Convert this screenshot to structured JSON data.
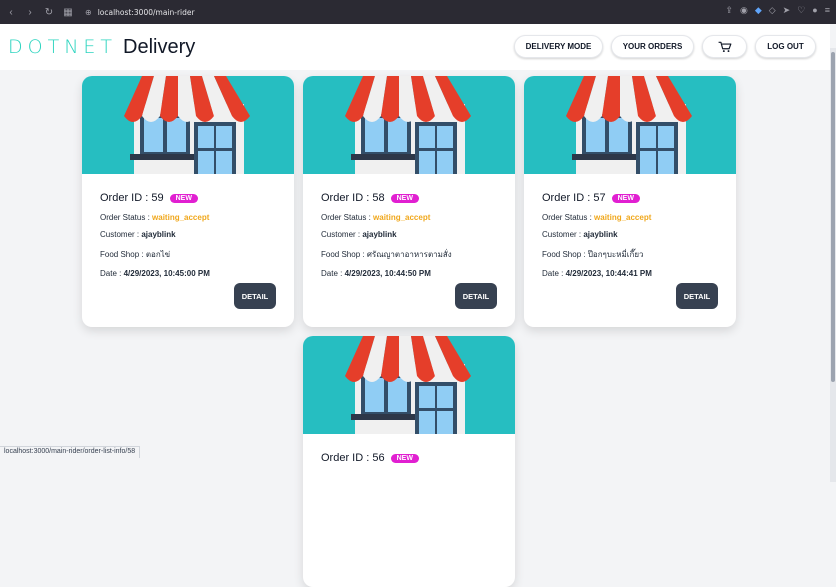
{
  "browser": {
    "url": "localhost:3000/main-rider",
    "status_link": "localhost:3000/main-rider/order-list-info/58"
  },
  "header": {
    "brand": "DOTNET",
    "brand_word": "Delivery",
    "buttons": {
      "delivery_mode": "DELIVERY MODE",
      "your_orders": "YOUR ORDERS",
      "log_out": "LOG OUT"
    }
  },
  "labels": {
    "order_id": "Order ID : ",
    "order_status": "Order Status : ",
    "customer": "Customer : ",
    "food_shop": "Food Shop : ",
    "date": "Date : ",
    "new_badge": "NEW",
    "detail": "DETAIL"
  },
  "orders": [
    {
      "id": "59",
      "status": "waiting_accept",
      "customer": "ajayblink",
      "food_shop": "ตอกไข่",
      "date": "4/29/2023, 10:45:00 PM"
    },
    {
      "id": "58",
      "status": "waiting_accept",
      "customer": "ajayblink",
      "food_shop": "ศรัณญาตาอาหารตามสั่ง",
      "date": "4/29/2023, 10:44:50 PM"
    },
    {
      "id": "57",
      "status": "waiting_accept",
      "customer": "ajayblink",
      "food_shop": "ป๊อกๆบะหมี่เกี๊ยว",
      "date": "4/29/2023, 10:44:41 PM"
    },
    {
      "id": "56",
      "status": "",
      "customer": "",
      "food_shop": "",
      "date": ""
    }
  ],
  "colors": {
    "brand_teal": "#2dd4bf",
    "card_image_bg": "#26bec1",
    "badge_new": "#e11fd1",
    "status_waiting": "#f0a71b",
    "detail_button": "#374151"
  },
  "icons": [
    "back-icon",
    "forward-icon",
    "reload-icon",
    "tab-icon",
    "site-info-icon",
    "cart-icon"
  ]
}
